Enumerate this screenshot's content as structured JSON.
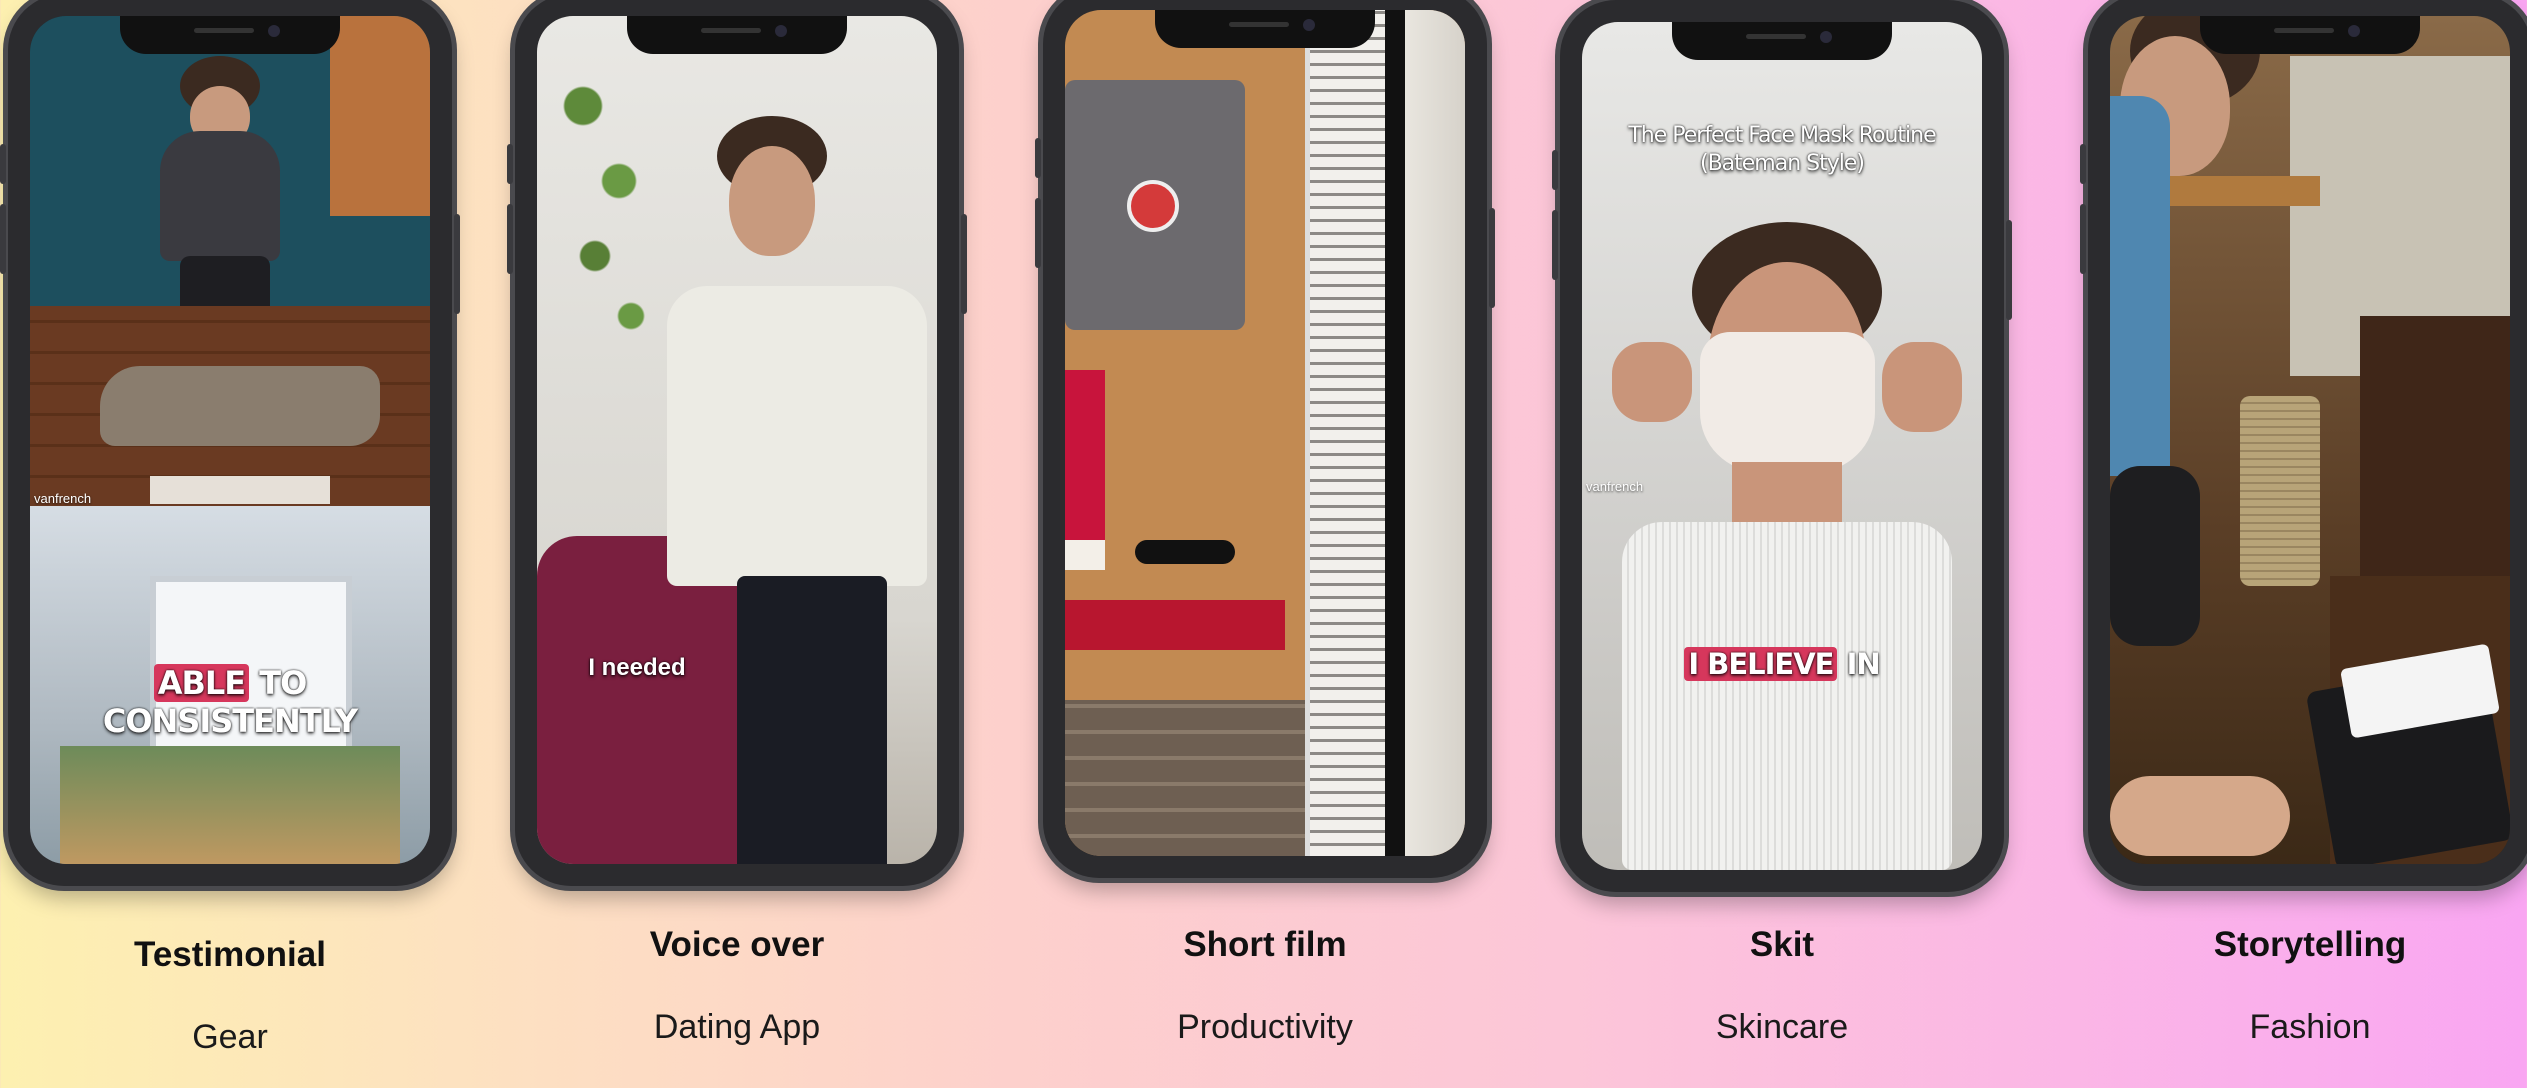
{
  "cards": [
    {
      "style_label": "Testimonial",
      "category": "Gear",
      "caption_highlight": "ABLE",
      "caption_rest": " TO CONSISTENTLY",
      "handle": "vanfrench"
    },
    {
      "style_label": "Voice over",
      "category": "Dating App",
      "caption": "I needed"
    },
    {
      "style_label": "Short film",
      "category": "Productivity"
    },
    {
      "style_label": "Skit",
      "category": "Skincare",
      "title_overlay": "The Perfect Face Mask Routine (Bateman Style)",
      "caption_highlight": "I BELIEVE",
      "caption_rest": " IN",
      "handle": "vanfrench"
    },
    {
      "style_label": "Storytelling",
      "category": "Fashion"
    }
  ],
  "colors": {
    "bg_left": "#fdf0b0",
    "bg_right": "#f9a6f2",
    "caption_highlight": "#d6375c",
    "phone_frame": "#2b2b2e"
  }
}
